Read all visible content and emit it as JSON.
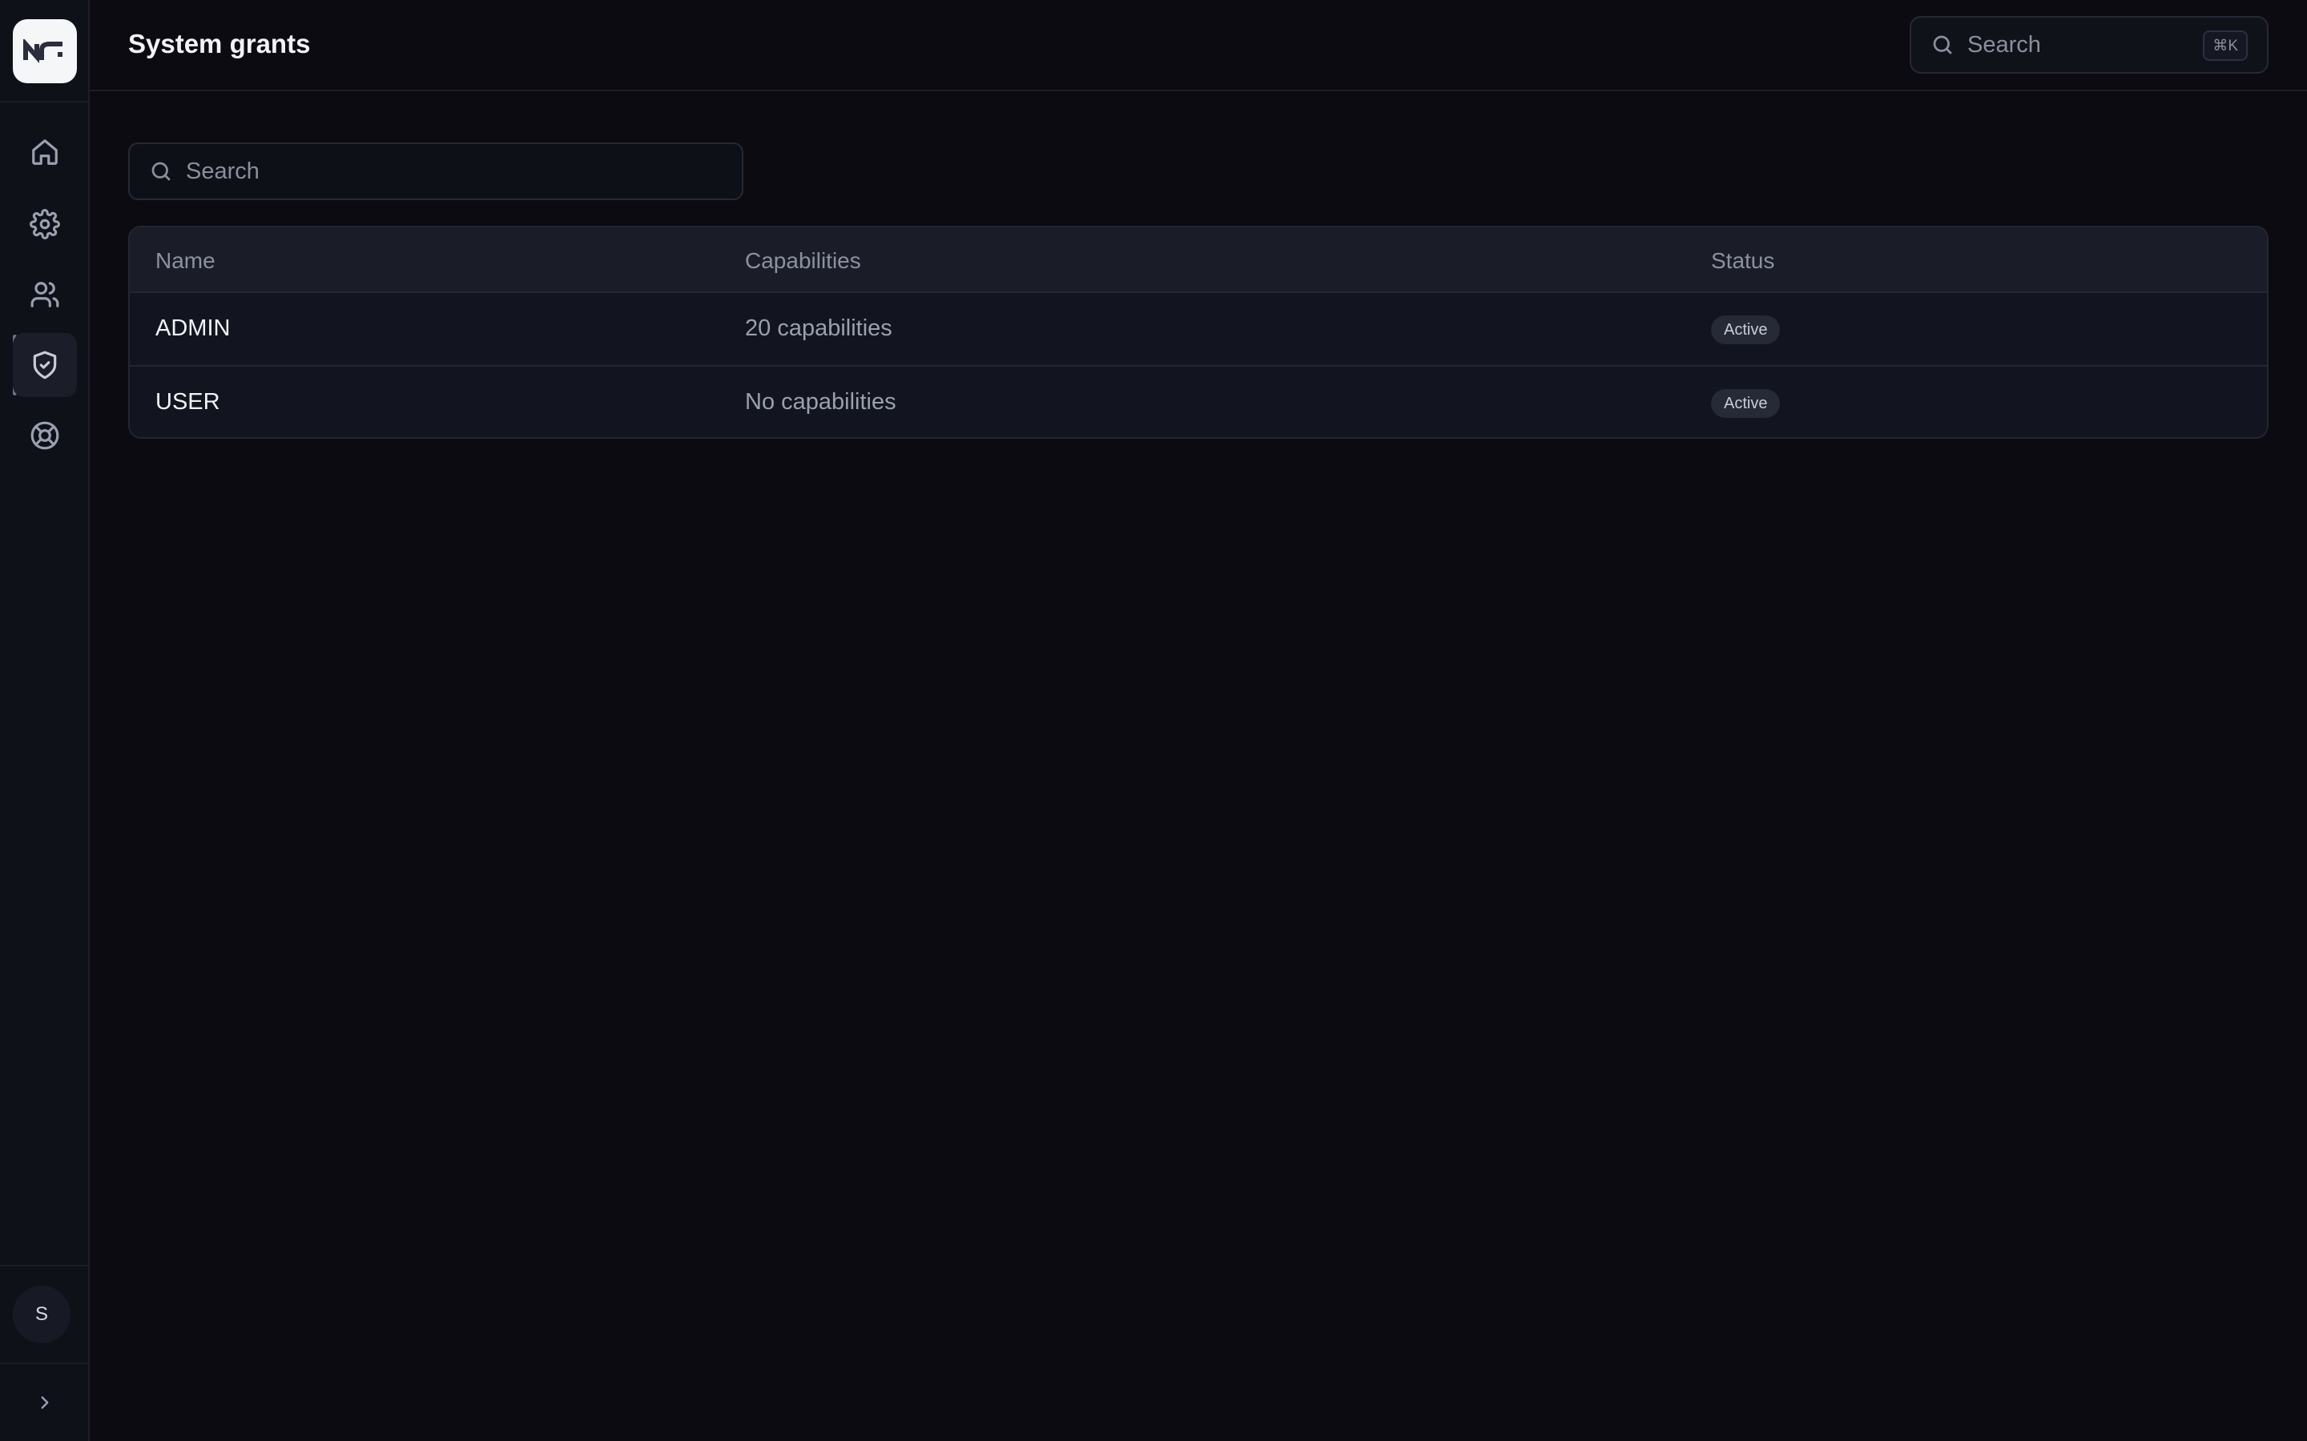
{
  "app": {
    "logo_text": "NF"
  },
  "sidebar": {
    "items": [
      {
        "id": "home",
        "icon": "home-icon"
      },
      {
        "id": "settings",
        "icon": "gear-icon"
      },
      {
        "id": "users",
        "icon": "users-icon"
      },
      {
        "id": "system-grants",
        "icon": "shield-check-icon",
        "active": true
      },
      {
        "id": "support",
        "icon": "lifebuoy-icon"
      }
    ],
    "user_initial": "S",
    "expand_icon": "chevron-right-icon"
  },
  "header": {
    "title": "System grants",
    "search_placeholder": "Search",
    "search_shortcut": "⌘K"
  },
  "main": {
    "search_placeholder": "Search",
    "table": {
      "columns": [
        "Name",
        "Capabilities",
        "Status"
      ],
      "rows": [
        {
          "name": "ADMIN",
          "capabilities": "20 capabilities",
          "status": "Active"
        },
        {
          "name": "USER",
          "capabilities": "No capabilities",
          "status": "Active"
        }
      ]
    }
  },
  "colors": {
    "background": "#0b0b11",
    "sidebar": "#0f1119",
    "table_header": "#1a1c28",
    "table_row": "#121520",
    "badge": "#262a36"
  }
}
